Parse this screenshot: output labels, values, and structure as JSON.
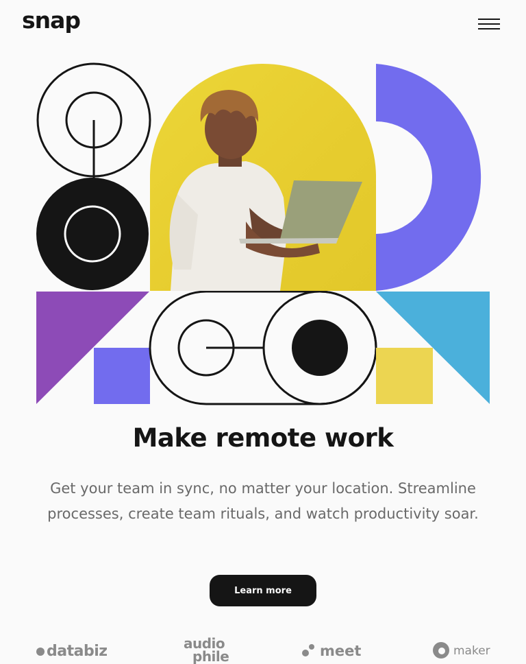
{
  "header": {
    "logo": "snap",
    "menu_icon": "hamburger-menu-icon"
  },
  "hero": {
    "title": "Make remote work",
    "subtitle": "Get your team in sync, no matter your location. Streamline processes, create team rituals, and watch productivity soar.",
    "cta_label": "Learn more",
    "photo_alt": "Man holding a laptop in front of a yellow background"
  },
  "clients": {
    "databiz": "databiz",
    "audiophile_line1": "audio",
    "audiophile_line2": "phile",
    "meet": "meet",
    "maker": "maker"
  },
  "colors": {
    "background": "#fafafa",
    "dark": "#151515",
    "yellow": "#e8d23a",
    "violet": "#726cee",
    "purple": "#8d4bb7",
    "blue": "#4bb0db",
    "gray_text": "#696969",
    "logo_gray": "#8a8a8a"
  }
}
